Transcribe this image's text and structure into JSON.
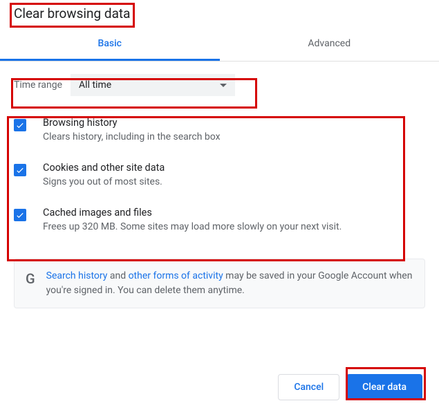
{
  "title": "Clear browsing data",
  "tabs": {
    "basic": "Basic",
    "advanced": "Advanced"
  },
  "timeRange": {
    "label": "Time range",
    "value": "All time"
  },
  "options": [
    {
      "title": "Browsing history",
      "desc": "Clears history, including in the search box"
    },
    {
      "title": "Cookies and other site data",
      "desc": "Signs you out of most sites."
    },
    {
      "title": "Cached images and files",
      "desc": "Frees up 320 MB. Some sites may load more slowly on your next visit."
    }
  ],
  "info": {
    "link1": "Search history",
    "mid1": " and ",
    "link2": "other forms of activity",
    "rest": " may be saved in your Google Account when you're signed in. You can delete them anytime."
  },
  "buttons": {
    "cancel": "Cancel",
    "clear": "Clear data"
  }
}
